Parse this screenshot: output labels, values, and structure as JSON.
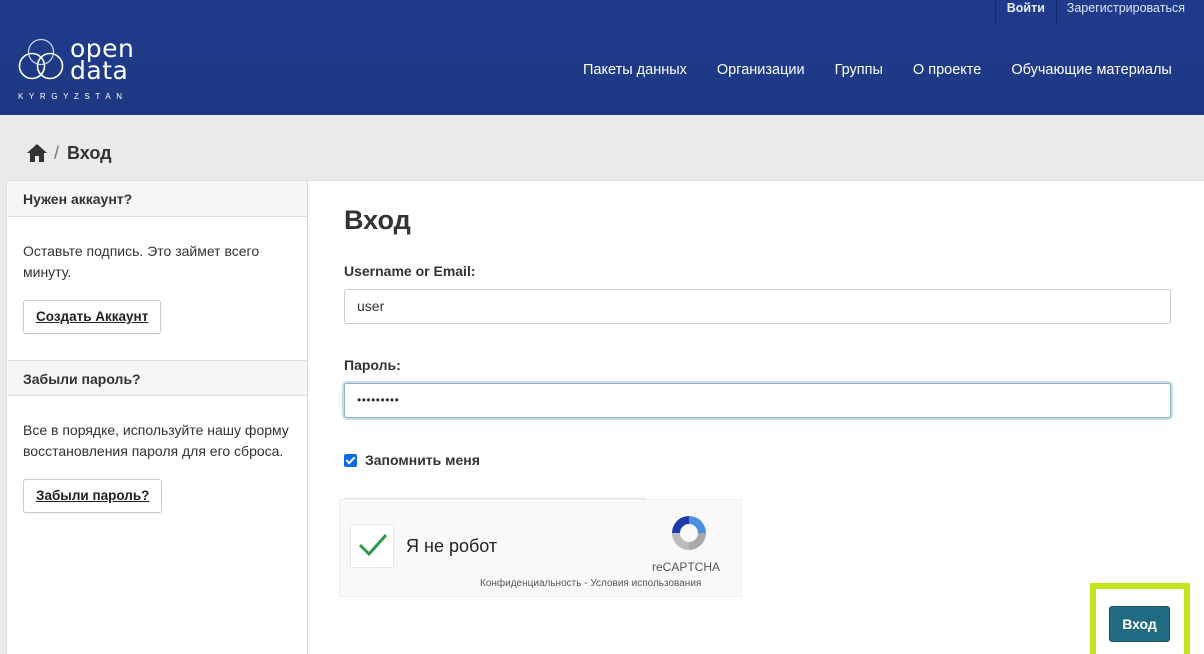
{
  "header": {
    "logo": {
      "line1": "open",
      "line2": "data",
      "tagline": "KYRGYZSTAN"
    },
    "account": {
      "login": "Войти",
      "register": "Зарегистрироваться"
    },
    "nav": [
      {
        "label": "Пакеты данных"
      },
      {
        "label": "Организации"
      },
      {
        "label": "Группы"
      },
      {
        "label": "О проекте"
      },
      {
        "label": "Обучающие материалы"
      }
    ],
    "colors": {
      "background": "#1e3a8a",
      "text": "#ffffff"
    }
  },
  "breadcrumb": {
    "home_icon": "home-icon",
    "separator": "/",
    "current": "Вход"
  },
  "sidebar": {
    "account": {
      "heading": "Нужен аккаунт?",
      "text": "Оставьте подпись. Это займет всего минуту.",
      "button": "Создать Аккаунт"
    },
    "forgot": {
      "heading": "Забыли пароль?",
      "text": "Все в порядке, используйте нашу форму восстановления пароля для его сброса.",
      "button": "Забыли пароль?"
    }
  },
  "form": {
    "title": "Вход",
    "username_label": "Username or Email:",
    "username_value": "user",
    "password_label": "Пароль:",
    "password_value": "•••••••••",
    "remember_label": "Запомнить меня",
    "remember_checked": true,
    "submit": "Вход",
    "submit_color": "#206b82",
    "highlight_color": "#bfe619"
  },
  "recaptcha": {
    "label": "Я не робот",
    "checked": true,
    "brand": "reCAPTCHA",
    "privacy": "Конфиденциальность",
    "terms_sep": " - ",
    "terms": "Условия использования"
  }
}
